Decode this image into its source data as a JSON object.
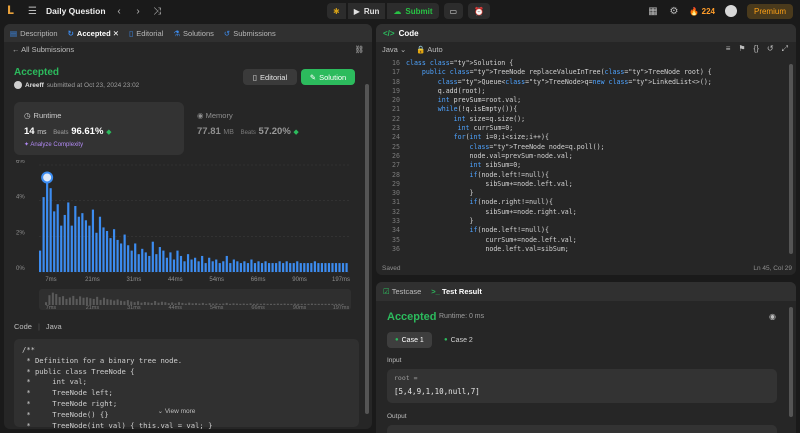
{
  "topbar": {
    "title": "Daily Question",
    "run_label": "Run",
    "submit_label": "Submit",
    "streak": "224",
    "premium_label": "Premium"
  },
  "left": {
    "tabs": [
      {
        "label": "Description"
      },
      {
        "label": "Accepted"
      },
      {
        "label": "Editorial"
      },
      {
        "label": "Solutions"
      },
      {
        "label": "Submissions"
      }
    ],
    "back_label": "All Submissions",
    "status": "Accepted",
    "submitter": "Areeff",
    "submitted_text": "submitted at Oct 23, 2024 23:02",
    "editorial_btn": "Editorial",
    "solution_btn": "Solution",
    "runtime": {
      "label": "Runtime",
      "value": "14",
      "unit": "ms",
      "beats_label": "Beats",
      "beats_value": "96.61%",
      "analyze": "Analyze Complexity"
    },
    "memory": {
      "label": "Memory",
      "value": "77.81",
      "unit": "MB",
      "beats_label": "Beats",
      "beats_value": "57.20%"
    },
    "code_header": {
      "label": "Code",
      "lang": "Java"
    },
    "code_lines": [
      "/**",
      " * Definition for a binary tree node.",
      " * public class TreeNode {",
      " *     int val;",
      " *     TreeNode left;",
      " *     TreeNode right;",
      " *     TreeNode() {}",
      " *     TreeNode(int val) { this.val = val; }"
    ],
    "view_more": "View more"
  },
  "chart_data": {
    "type": "bar",
    "ylim": [
      0,
      6
    ],
    "yticks": [
      "0%",
      "2%",
      "4%",
      "6%"
    ],
    "xticks": [
      "7ms",
      "21ms",
      "31ms",
      "44ms",
      "54ms",
      "66ms",
      "90ms",
      "197ms"
    ],
    "highlight_index": 2,
    "values": [
      1.2,
      4.2,
      5.3,
      4.7,
      3.4,
      3.8,
      2.6,
      3.2,
      3.9,
      2.6,
      3.7,
      3.1,
      3.3,
      2.9,
      2.6,
      3.5,
      2.2,
      3.1,
      2.5,
      2.3,
      1.9,
      2.4,
      1.8,
      1.6,
      2.1,
      1.5,
      1.2,
      1.6,
      1.0,
      1.3,
      1.1,
      0.9,
      1.7,
      1.0,
      1.4,
      1.2,
      0.8,
      1.1,
      0.7,
      1.2,
      0.9,
      0.6,
      1.0,
      0.7,
      0.8,
      0.6,
      0.9,
      0.5,
      0.8,
      0.6,
      0.7,
      0.5,
      0.6,
      0.9,
      0.5,
      0.7,
      0.6,
      0.5,
      0.6,
      0.5,
      0.7,
      0.5,
      0.6,
      0.5,
      0.6,
      0.5,
      0.5,
      0.5,
      0.6,
      0.5,
      0.6,
      0.5,
      0.5,
      0.6,
      0.5,
      0.5,
      0.5,
      0.5,
      0.6,
      0.5,
      0.5,
      0.5,
      0.5,
      0.5,
      0.5,
      0.5,
      0.5,
      0.5
    ]
  },
  "editor": {
    "tab_label": "Code",
    "language": "Java",
    "mode": "Auto",
    "start_line": 16,
    "lines": [
      "class Solution {",
      "    public TreeNode replaceValueInTree(TreeNode root) {",
      "        Queue<TreeNode>q=new LinkedList<>();",
      "        q.add(root);",
      "        int prevSum=root.val;",
      "        while(!q.isEmpty()){",
      "            int size=q.size();",
      "             int currSum=0;",
      "            for(int i=0;i<size;i++){",
      "                TreeNode node=q.poll();",
      "                node.val=prevSum-node.val;",
      "                int sibSum=0;",
      "                if(node.left!=null){",
      "                    sibSum+=node.left.val;",
      "                }",
      "                if(node.right!=null){",
      "                    sibSum+=node.right.val;",
      "                }",
      "                if(node.left!=null){",
      "                    currSum+=node.left.val;",
      "                    node.left.val=sibSum;"
    ],
    "saved": "Saved",
    "cursor": "Ln 45, Col 29"
  },
  "result": {
    "tabs": [
      {
        "label": "Testcase"
      },
      {
        "label": "Test Result"
      }
    ],
    "status": "Accepted",
    "runtime_text": "Runtime: 0 ms",
    "cases": [
      "Case 1",
      "Case 2"
    ],
    "input_label": "Input",
    "input_var": "root =",
    "input_value": "[5,4,9,1,10,null,7]",
    "output_label": "Output"
  }
}
